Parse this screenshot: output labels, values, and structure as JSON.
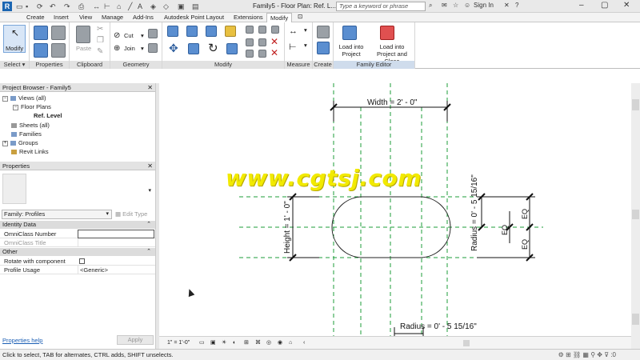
{
  "titlebar": {
    "app_letter": "R",
    "title": "Family5 - Floor Plan: Ref. L...",
    "search_placeholder": "Type a keyword or phrase",
    "signin": "Sign In"
  },
  "tabs": [
    "Create",
    "Insert",
    "View",
    "Manage",
    "Add-Ins",
    "Autodesk Point Layout",
    "Extensions",
    "Modify"
  ],
  "active_tab": "Modify",
  "ribbon": {
    "select": {
      "button": "Modify",
      "label": "Select"
    },
    "properties": {
      "label": "Properties"
    },
    "clipboard": {
      "paste": "Paste",
      "label": "Clipboard"
    },
    "geometry": {
      "cut": "Cut",
      "join": "Join",
      "label": "Geometry"
    },
    "modify": {
      "label": "Modify"
    },
    "measure": {
      "label": "Measure"
    },
    "create": {
      "label": "Create"
    },
    "family_editor": {
      "load": "Load into Project",
      "load_close": "Load into Project and Close",
      "label": "Family Editor"
    }
  },
  "project_browser": {
    "title": "Project Browser - Family5",
    "items": [
      {
        "label": "Views (all)",
        "toggle": "−"
      },
      {
        "label": "Floor Plans",
        "toggle": "−"
      },
      {
        "label": "Ref. Level",
        "toggle": ""
      },
      {
        "label": "Sheets (all)",
        "toggle": ""
      },
      {
        "label": "Families",
        "toggle": ""
      },
      {
        "label": "Groups",
        "toggle": "+"
      },
      {
        "label": "Revit Links",
        "toggle": ""
      }
    ]
  },
  "properties": {
    "title": "Properties",
    "family": "Family: Profiles",
    "edit_type": "Edit Type",
    "groups": [
      {
        "label": "Identity Data"
      },
      {
        "label": "Other"
      }
    ],
    "rows": [
      {
        "key": "OmniClass Number",
        "value": ""
      },
      {
        "key": "OmniClass Title",
        "value": ""
      },
      {
        "key": "Rotate with component",
        "value": ""
      },
      {
        "key": "Profile Usage",
        "value": "<Generic>"
      }
    ],
    "help": "Properties help",
    "apply": "Apply"
  },
  "drawing": {
    "width_dim": "Width = 2' - 0\"",
    "height_dim": "Height = 1' - 0\"",
    "radius_dim_right": "Radius = 0' - 5 15/16\"",
    "radius_dim_bottom": "Radius = 0' - 5 15/16\"",
    "eq_labels": [
      "EQ",
      "EQ",
      "EQ",
      "EQ"
    ]
  },
  "watermark": "www.cgtsj.com",
  "view_control": {
    "scale": "1\" = 1'-0\""
  },
  "status": {
    "message": "Click to select, TAB for alternates, CTRL adds, SHIFT unselects.",
    "filter": ":0"
  },
  "colors": {
    "ref_plane": "#1e9e3a",
    "dim_line": "#111111",
    "shape": "#222222",
    "watermark": "#f2ea00"
  }
}
